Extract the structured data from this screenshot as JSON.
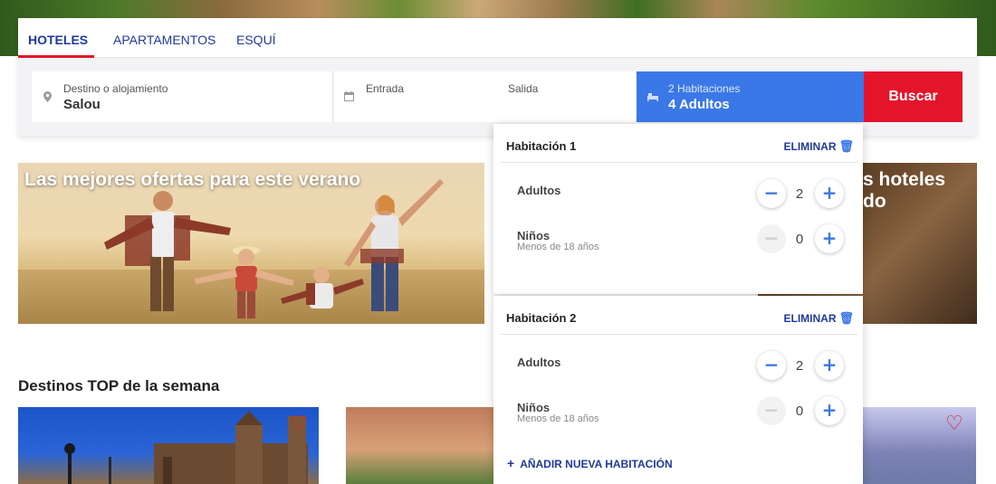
{
  "tabs": [
    {
      "label": "HOTELES",
      "active": true
    },
    {
      "label": "APARTAMENTOS",
      "active": false
    },
    {
      "label": "ESQUÍ",
      "active": false
    }
  ],
  "search": {
    "destination_label": "Destino o alojamiento",
    "destination_value": "Salou",
    "checkin_label": "Entrada",
    "checkout_label": "Salida",
    "rooms_label": "2 Habitaciones",
    "rooms_value": "4 Adultos",
    "search_button": "Buscar"
  },
  "banners": {
    "left_title": "Las mejores ofertas para este verano",
    "right_title_line1": "s hoteles",
    "right_title_line2": "do"
  },
  "top_destinations_title": "Destinos TOP de la semana",
  "rooms": [
    {
      "title": "Habitación 1",
      "delete_label": "ELIMINAR",
      "adults_label": "Adultos",
      "adults_value": "2",
      "children_label": "Niños",
      "children_sub": "Menos de 18 años",
      "children_value": "0"
    },
    {
      "title": "Habitación 2",
      "delete_label": "ELIMINAR",
      "adults_label": "Adultos",
      "adults_value": "2",
      "children_label": "Niños",
      "children_sub": "Menos de 18 años",
      "children_value": "0"
    }
  ],
  "add_room_label": "AÑADIR NUEVA HABITACIÓN",
  "icons": {
    "location": "location-pin-icon",
    "calendar": "calendar-icon",
    "bed": "bed-icon",
    "trash": "trash-icon",
    "heart": "heart-icon"
  },
  "colors": {
    "brand_blue": "#1f3a9e",
    "accent_blue": "#3b78e7",
    "search_red": "#e4152a"
  }
}
